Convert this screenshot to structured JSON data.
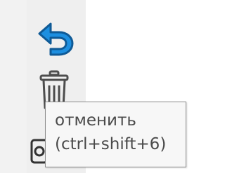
{
  "toolbar": {
    "undo": {
      "icon": "undo-arrow-icon",
      "color": "#1d8fe0"
    },
    "delete": {
      "icon": "trash-icon",
      "color": "#4d4d4d"
    },
    "third": {
      "icon": "partially-hidden-icon"
    }
  },
  "tooltip": {
    "title": "отменить",
    "shortcut": "(ctrl+shift+6)"
  }
}
